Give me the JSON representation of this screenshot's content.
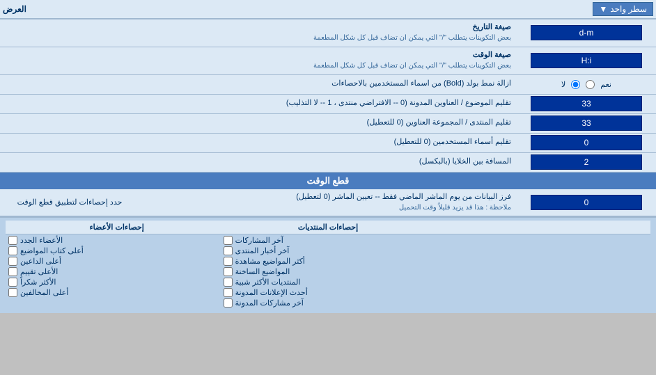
{
  "header": {
    "right_label": "العرض",
    "dropdown_label": "سطر واحد"
  },
  "rows": [
    {
      "label": "صيغة التاريخ",
      "sublabel": "بعض التكوينات يتطلب \"/\" التي يمكن ان تضاف قبل كل شكل المطعمة",
      "value": "d-m",
      "type": "input"
    },
    {
      "label": "صيغة الوقت",
      "sublabel": "بعض التكوينات يتطلب \"/\" التي يمكن ان تضاف قبل كل شكل المطعمة",
      "value": "H:i",
      "type": "input"
    },
    {
      "label": "ازالة نمط بولد (Bold) من اسماء المستخدمين بالاحصاءات",
      "sublabel": "",
      "value": "",
      "type": "radio",
      "radio_yes": "نعم",
      "radio_no": "لا",
      "selected": "no"
    },
    {
      "label": "تقليم الموضوع / العناوين المدونة (0 -- الافتراضي منتدى ، 1 -- لا التذليب)",
      "sublabel": "",
      "value": "33",
      "type": "input"
    },
    {
      "label": "تقليم المنتدى / المجموعة العناوين (0 للتعطيل)",
      "sublabel": "",
      "value": "33",
      "type": "input"
    },
    {
      "label": "تقليم أسماء المستخدمين (0 للتعطيل)",
      "sublabel": "",
      "value": "0",
      "type": "input"
    },
    {
      "label": "المسافة بين الخلايا (بالبكسل)",
      "sublabel": "",
      "value": "2",
      "type": "input"
    }
  ],
  "cutoff_section": {
    "header": "قطع الوقت",
    "row": {
      "label": "فرز البيانات من يوم الماشر الماضي فقط -- تعيين الماشر (0 لتعطيل)",
      "sublabel": "ملاحظة : هذا قد يزيد قليلاً وقت التحميل",
      "value": "0"
    },
    "stats_label": "حدد إحصاءات لتطبيق قطع الوقت"
  },
  "checkboxes": {
    "col1_header": "إحصاءات الأعضاء",
    "col2_header": "إحصاءات المنتديات",
    "col3_header": "",
    "col1_items": [
      {
        "label": "الأعضاء الجدد",
        "checked": false
      },
      {
        "label": "أعلى كتاب المواضيع",
        "checked": false
      },
      {
        "label": "أعلى الداعين",
        "checked": false
      },
      {
        "label": "الأعلى تقييم",
        "checked": false
      },
      {
        "label": "الأكثر شكراً",
        "checked": false
      },
      {
        "label": "أعلى المخالفين",
        "checked": false
      }
    ],
    "col2_items": [
      {
        "label": "آخر المشاركات",
        "checked": false
      },
      {
        "label": "آخر أخبار المنتدى",
        "checked": false
      },
      {
        "label": "أكثر المواضيع مشاهدة",
        "checked": false
      },
      {
        "label": "المواضيع الساخنة",
        "checked": false
      },
      {
        "label": "المنتديات الأكثر شبية",
        "checked": false
      },
      {
        "label": "أحدث الإعلانات المدونة",
        "checked": false
      },
      {
        "label": "آخر مشاركات المدونة",
        "checked": false
      }
    ]
  }
}
